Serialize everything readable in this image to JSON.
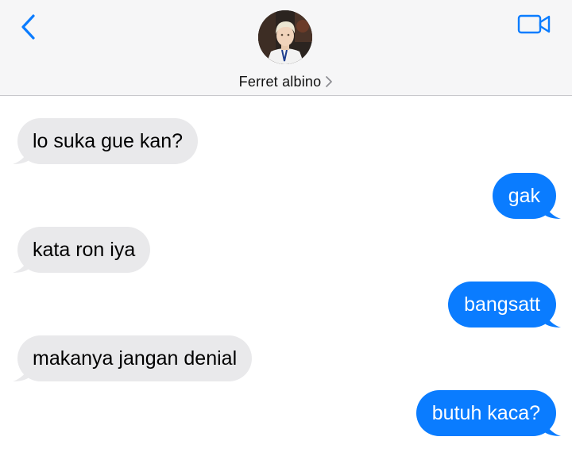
{
  "header": {
    "contact_name": "Ferret albino",
    "back_icon": "chevron-left-icon",
    "video_icon": "video-camera-icon",
    "accent_color": "#0a7cff"
  },
  "messages": [
    {
      "direction": "incoming",
      "text": "lo suka gue kan?"
    },
    {
      "direction": "outgoing",
      "text": "gak"
    },
    {
      "direction": "incoming",
      "text": "kata ron iya"
    },
    {
      "direction": "outgoing",
      "text": "bangsatt"
    },
    {
      "direction": "incoming",
      "text": "makanya jangan denial"
    },
    {
      "direction": "outgoing",
      "text": "butuh kaca?"
    }
  ],
  "colors": {
    "incoming_bubble": "#e9e9eb",
    "outgoing_bubble": "#0a7cff",
    "header_bg": "#f6f6f7"
  }
}
